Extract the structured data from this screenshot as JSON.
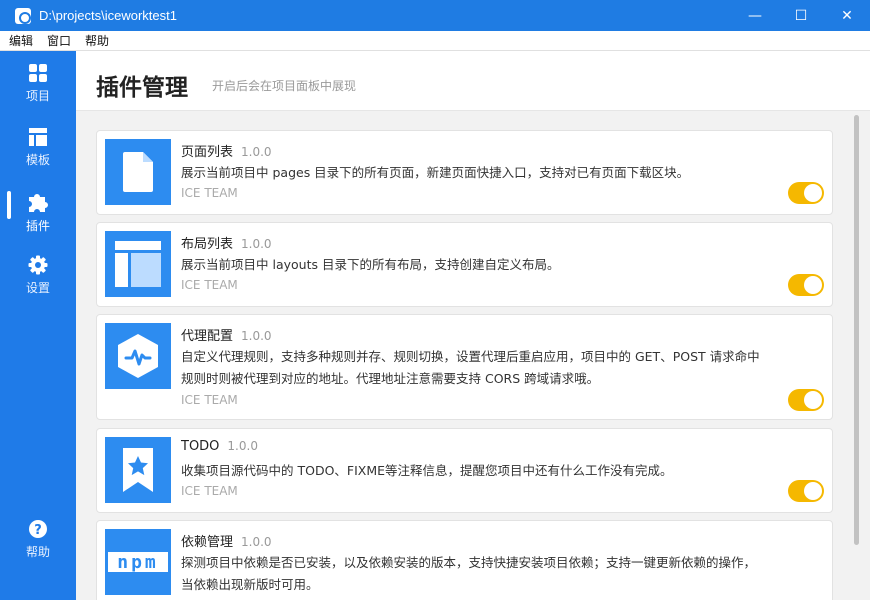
{
  "window": {
    "title": "D:\\projects\\iceworktest1",
    "minimize": "—",
    "maximize": "☐",
    "close": "✕"
  },
  "menu": [
    "编辑",
    "窗口",
    "帮助"
  ],
  "sidebar": {
    "items": [
      {
        "label": "项目",
        "icon": "grid-icon"
      },
      {
        "label": "模板",
        "icon": "layout-icon"
      },
      {
        "label": "插件",
        "icon": "puzzle-icon",
        "active": true
      },
      {
        "label": "设置",
        "icon": "gear-icon"
      }
    ],
    "help": {
      "label": "帮助",
      "icon": "question-icon"
    }
  },
  "header": {
    "title": "插件管理",
    "subtitle": "开启后会在项目面板中展现"
  },
  "plugins": [
    {
      "name": "页面列表",
      "version": "1.0.0",
      "desc_lines": [
        "展示当前项目中 pages 目录下的所有页面，新建页面快捷入口，支持对已有页面下载区块。"
      ],
      "author": "ICE TEAM",
      "enabled": true,
      "icon": "page-icon"
    },
    {
      "name": "布局列表",
      "version": "1.0.0",
      "desc_lines": [
        "展示当前项目中 layouts 目录下的所有布局，支持创建自定义布局。"
      ],
      "author": "ICE TEAM",
      "enabled": true,
      "icon": "layout-icon"
    },
    {
      "name": "代理配置",
      "version": "1.0.0",
      "desc_lines": [
        "自定义代理规则，支持多种规则并存、规则切换，设置代理后重启应用，项目中的 GET、POST 请求命中",
        "规则时则被代理到对应的地址。代理地址注意需要支持 CORS 跨域请求哦。"
      ],
      "author": "ICE TEAM",
      "enabled": true,
      "icon": "proxy-icon"
    },
    {
      "name": "TODO",
      "version": "1.0.0",
      "desc_lines": [
        "收集项目源代码中的 TODO、FIXME等注释信息，提醒您项目中还有什么工作没有完成。"
      ],
      "author": "ICE TEAM",
      "enabled": true,
      "icon": "bookmark-star-icon"
    },
    {
      "name": "依赖管理",
      "version": "1.0.0",
      "desc_lines": [
        "探测项目中依赖是否已安装，以及依赖安装的版本，支持快捷安装项目依赖；支持一键更新依赖的操作，",
        "当依赖出现新版时可用。"
      ],
      "author": "",
      "enabled": true,
      "icon": "npm-icon",
      "npm_text": "npm"
    }
  ],
  "colors": {
    "accent": "#1f7be8",
    "toggle_on": "#f5b800",
    "icon_bg": "#2d8cf0"
  }
}
